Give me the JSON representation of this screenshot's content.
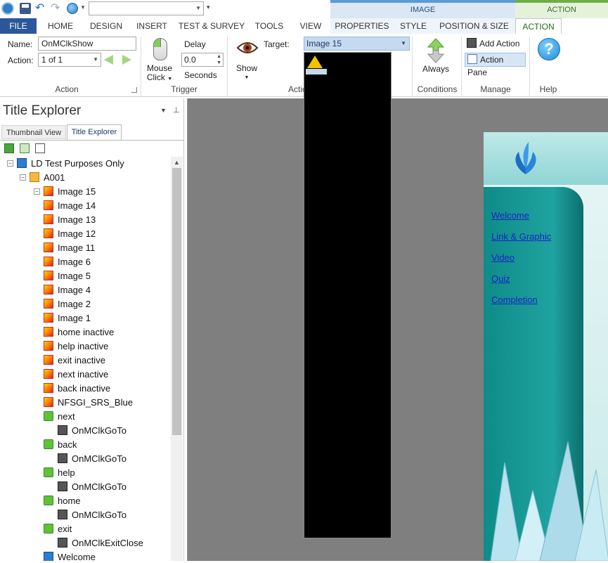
{
  "app": {
    "accent": "#2b579a",
    "context_color": "#c9dcef",
    "action_color": "#dff0d8"
  },
  "context_tabs": {
    "image": "IMAGE",
    "action": "ACTION"
  },
  "tabs": [
    "FILE",
    "HOME",
    "DESIGN",
    "INSERT",
    "TEST & SURVEY",
    "TOOLS",
    "VIEW",
    "PROPERTIES",
    "STYLE",
    "POSITION & SIZE",
    "ACTION"
  ],
  "ribbon": {
    "name_label": "Name:",
    "name_value": "OnMClkShow",
    "action_label": "Action:",
    "action_value": "1 of 1",
    "action_group": "Action",
    "mouse_click": "Mouse",
    "mouse_click2": "Click",
    "delay_label": "Delay",
    "delay_value": "0.0",
    "seconds_label": "Seconds",
    "trigger_group": "Trigger",
    "show_label": "Show",
    "target_label": "Target:",
    "target_value": "Image 15",
    "action_group2": "Actio",
    "always_label": "Always",
    "conditions_group": "Conditions",
    "add_action": "Add Action",
    "action_pane": "Action Pane",
    "manage_group": "Manage",
    "help_group": "Help"
  },
  "explorer": {
    "title": "Title Explorer",
    "tab_thumbnail": "Thumbnail View",
    "tab_title": "Title Explorer",
    "tree": [
      {
        "label": "LD Test Purposes Only",
        "type": "root",
        "indent": 0
      },
      {
        "label": "A001",
        "type": "folder",
        "indent": 1
      },
      {
        "label": "Image 15",
        "type": "image",
        "indent": 2
      },
      {
        "label": "Image 14",
        "type": "image",
        "indent": 2
      },
      {
        "label": "Image 13",
        "type": "image",
        "indent": 2
      },
      {
        "label": "Image 12",
        "type": "image",
        "indent": 2
      },
      {
        "label": "Image 11",
        "type": "image",
        "indent": 2
      },
      {
        "label": "Image 6",
        "type": "image",
        "indent": 2
      },
      {
        "label": "Image 5",
        "type": "image",
        "indent": 2
      },
      {
        "label": "Image 4",
        "type": "image",
        "indent": 2
      },
      {
        "label": "Image 2",
        "type": "image",
        "indent": 2
      },
      {
        "label": "Image 1",
        "type": "image",
        "indent": 2
      },
      {
        "label": "home inactive",
        "type": "image",
        "indent": 2
      },
      {
        "label": "help inactive",
        "type": "image",
        "indent": 2
      },
      {
        "label": "exit inactive",
        "type": "image",
        "indent": 2
      },
      {
        "label": "next inactive",
        "type": "image",
        "indent": 2
      },
      {
        "label": "back inactive",
        "type": "image",
        "indent": 2
      },
      {
        "label": "NFSGI_SRS_Blue",
        "type": "image",
        "indent": 2
      },
      {
        "label": "next",
        "type": "button",
        "indent": 2
      },
      {
        "label": "OnMClkGoTo",
        "type": "action",
        "indent": 3
      },
      {
        "label": "back",
        "type": "button",
        "indent": 2
      },
      {
        "label": "OnMClkGoTo",
        "type": "action",
        "indent": 3
      },
      {
        "label": "help",
        "type": "button",
        "indent": 2
      },
      {
        "label": "OnMClkGoTo",
        "type": "action",
        "indent": 3
      },
      {
        "label": "home",
        "type": "button",
        "indent": 2
      },
      {
        "label": "OnMClkGoTo",
        "type": "action",
        "indent": 3
      },
      {
        "label": "exit",
        "type": "button",
        "indent": 2
      },
      {
        "label": "OnMClkExitClose",
        "type": "action",
        "indent": 3
      },
      {
        "label": "Welcome",
        "type": "text",
        "indent": 2
      }
    ]
  },
  "page_links": [
    "Welcome",
    "Link & Graphic",
    "Video",
    "Quiz",
    "Completion"
  ]
}
